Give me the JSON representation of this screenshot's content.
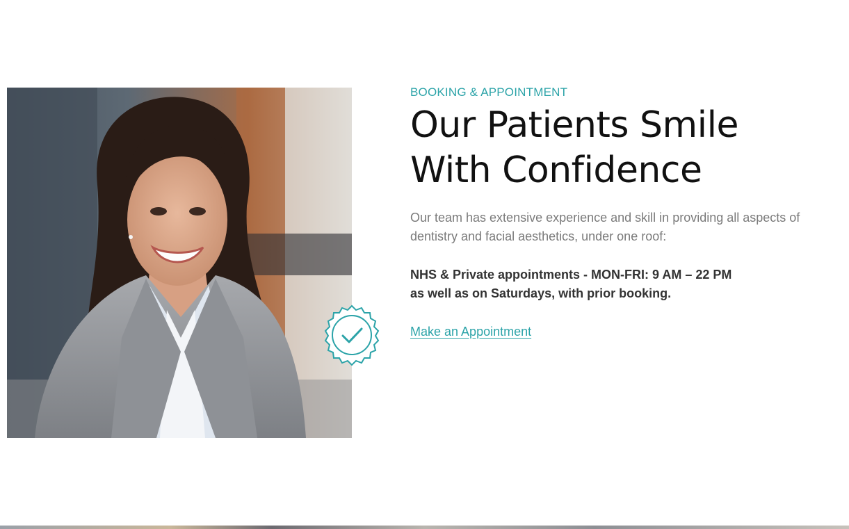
{
  "section": {
    "eyebrow": "BOOKING & APPOINTMENT",
    "heading_line1": "Our Patients Smile",
    "heading_line2": "With Confidence",
    "description": "Our team has extensive experience and skill in providing all aspects of dentistry and facial aesthetics, under one roof:",
    "hours_line1": "NHS & Private appointments - MON-FRI: 9 AM – 22 PM",
    "hours_line2": "as well as on Saturdays, with prior booking.",
    "cta_label": "Make an Appointment"
  },
  "image": {
    "alt": "Smiling woman in grey blazer"
  },
  "badge": {
    "icon": "verified-check-badge-icon"
  },
  "colors": {
    "accent": "#2ba3a8",
    "heading": "#111111",
    "body": "#7a7a7a",
    "strong": "#333333"
  }
}
